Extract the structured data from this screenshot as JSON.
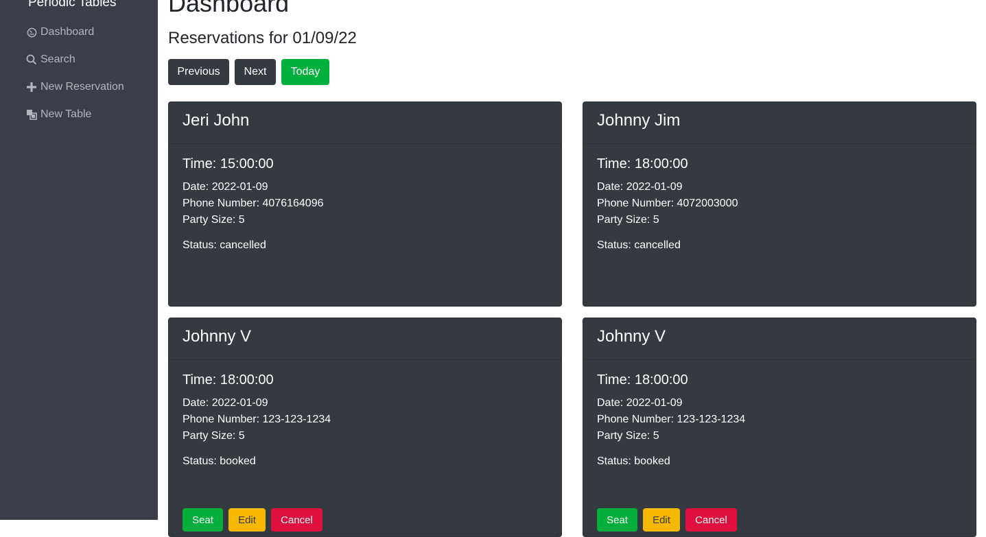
{
  "sidebar": {
    "brand": "Periodic Tables",
    "items": [
      {
        "label": "Dashboard",
        "icon": "dashboard-icon"
      },
      {
        "label": "Search",
        "icon": "search-icon"
      },
      {
        "label": "New Reservation",
        "icon": "plus-icon"
      },
      {
        "label": "New Table",
        "icon": "table-icon"
      }
    ]
  },
  "main": {
    "title": "Dashboard",
    "subtitle": "Reservations for 01/09/22",
    "buttons": {
      "previous": "Previous",
      "next": "Next",
      "today": "Today"
    },
    "reservations": [
      {
        "name": "Jeri John",
        "time": "Time: 15:00:00",
        "date": "Date: 2022-01-09",
        "phone": "Phone Number: 4076164096",
        "party": "Party Size: 5",
        "status": "Status: cancelled"
      },
      {
        "name": "Johnny Jim",
        "time": "Time: 18:00:00",
        "date": "Date: 2022-01-09",
        "phone": "Phone Number: 4072003000",
        "party": "Party Size: 5",
        "status": "Status: cancelled"
      },
      {
        "name": "Johnny V",
        "time": "Time: 18:00:00",
        "date": "Date: 2022-01-09",
        "phone": "Phone Number: 123-123-1234",
        "party": "Party Size: 5",
        "status": "Status: booked",
        "actions": {
          "seat": "Seat",
          "edit": "Edit",
          "cancel": "Cancel"
        }
      },
      {
        "name": "Johnny V",
        "time": "Time: 18:00:00",
        "date": "Date: 2022-01-09",
        "phone": "Phone Number: 123-123-1234",
        "party": "Party Size: 5",
        "status": "Status: booked",
        "actions": {
          "seat": "Seat",
          "edit": "Edit",
          "cancel": "Cancel"
        }
      }
    ]
  },
  "colors": {
    "sidebar_bg": "#3b3d49",
    "card_bg": "#343a40",
    "success": "#02b03d",
    "warning": "#f6b800",
    "danger": "#df0f3e"
  }
}
